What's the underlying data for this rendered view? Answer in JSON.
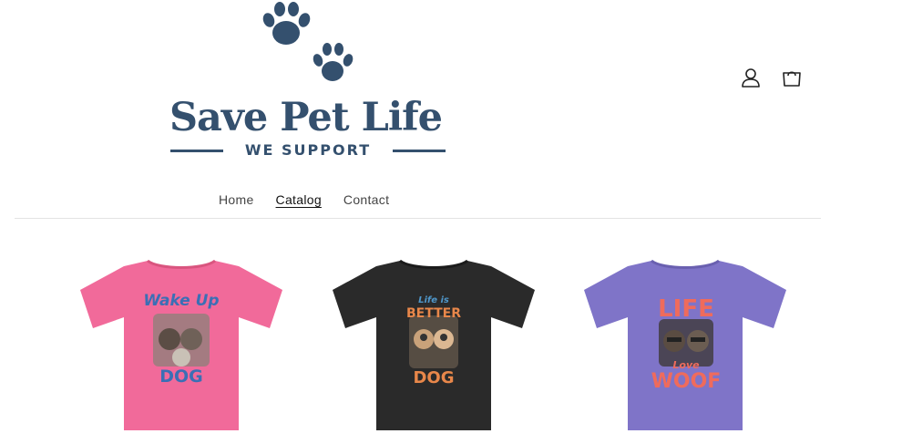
{
  "brand": {
    "name": "Save Pet Life",
    "tagline": "WE SUPPORT",
    "color": "#34506e"
  },
  "header": {
    "account_icon": "user-icon",
    "cart_icon": "shopping-bag-icon"
  },
  "nav": {
    "items": [
      {
        "label": "Home",
        "active": false
      },
      {
        "label": "Catalog",
        "active": true
      },
      {
        "label": "Contact",
        "active": false
      }
    ]
  },
  "products": [
    {
      "shirt_color": "#f16a9a",
      "print_lines": [
        "Wake Up",
        "DOG"
      ],
      "print_color": "#3b6fb5"
    },
    {
      "shirt_color": "#2a2a2a",
      "print_lines": [
        "Life is",
        "BETTER",
        "DOG"
      ],
      "print_color": "#e8874a"
    },
    {
      "shirt_color": "#7f74c8",
      "print_lines": [
        "LIFE",
        "Love",
        "WOOF"
      ],
      "print_color": "#ef6b5c"
    }
  ]
}
